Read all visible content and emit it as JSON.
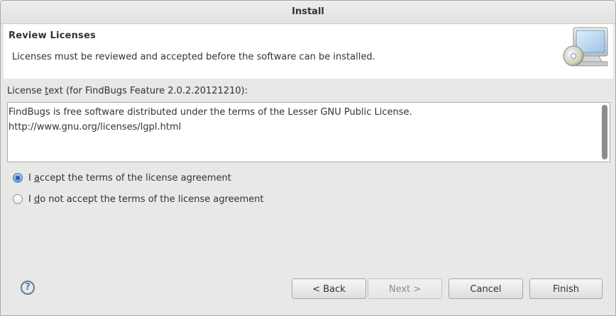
{
  "window": {
    "title": "Install"
  },
  "banner": {
    "title": "Review Licenses",
    "description": "Licenses must be reviewed and accepted before the software can be installed.",
    "icon": "install-computer-cd-icon"
  },
  "license": {
    "label_pre": "License ",
    "label_mnemonic": "t",
    "label_post": "ext (for FindBugs Feature 2.0.2.20121210):",
    "text": "FindBugs is free software distributed under the terms of the Lesser GNU Public License.\nhttp://www.gnu.org/licenses/lgpl.html"
  },
  "options": {
    "accept_pre": "I ",
    "accept_mnemonic": "a",
    "accept_post": "ccept the terms of the license agreement",
    "accept_selected": true,
    "decline_pre": "I ",
    "decline_mnemonic": "d",
    "decline_post": "o not accept the terms of the license agreement",
    "decline_selected": false
  },
  "buttons": {
    "help_glyph": "?",
    "back": "< Back",
    "next": "Next >",
    "cancel": "Cancel",
    "finish": "Finish"
  },
  "colors": {
    "accent": "#4a7dbb",
    "help": "#5d7ea6"
  }
}
